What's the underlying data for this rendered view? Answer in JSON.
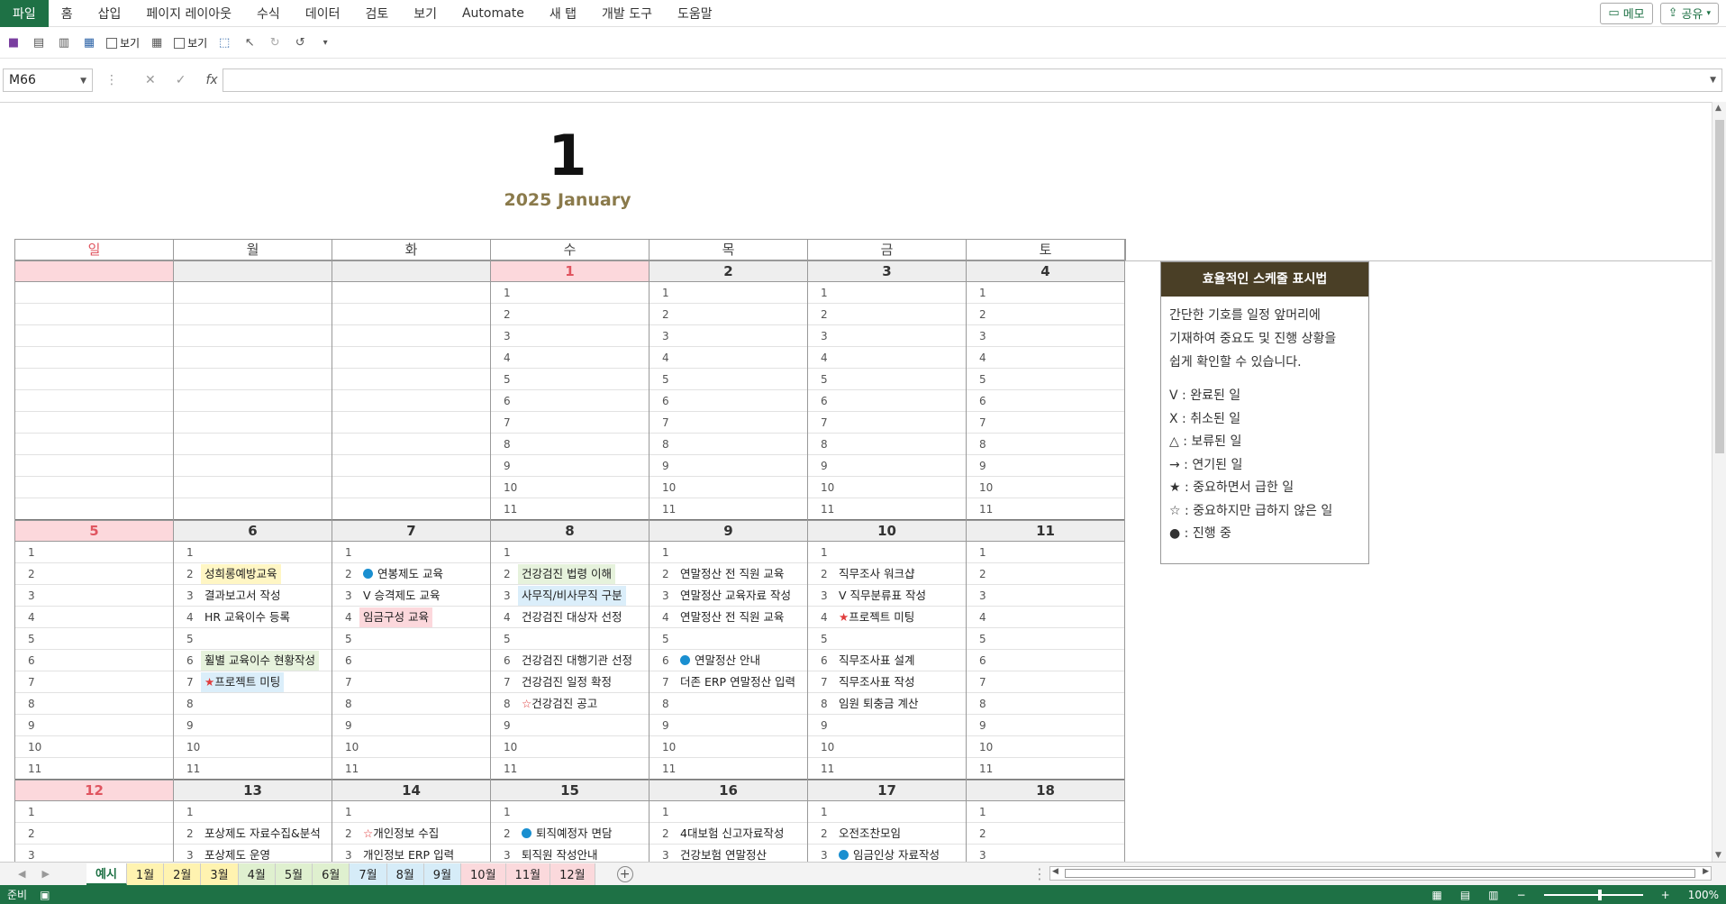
{
  "menu": {
    "file": "파일",
    "items": [
      "홈",
      "삽입",
      "페이지 레이아웃",
      "수식",
      "데이터",
      "검토",
      "보기",
      "Automate",
      "새 탭",
      "개발 도구",
      "도움말"
    ],
    "memo": "메모",
    "share": "공유"
  },
  "qat": {
    "view1": "보기",
    "view2": "보기"
  },
  "formula": {
    "cell_ref": "M66",
    "fx": "fx",
    "value": ""
  },
  "calendar": {
    "month_number": "1",
    "subtitle": "2025 January",
    "days": [
      "일",
      "월",
      "화",
      "수",
      "목",
      "금",
      "토"
    ],
    "weeks": [
      {
        "dates": [
          "",
          "",
          "",
          "1",
          "2",
          "3",
          "4"
        ],
        "rows": 11,
        "cols": [
          {
            "show_nums": false,
            "items": []
          },
          {
            "show_nums": false,
            "items": []
          },
          {
            "show_nums": false,
            "items": []
          },
          {
            "show_nums": true,
            "items": []
          },
          {
            "show_nums": true,
            "items": []
          },
          {
            "show_nums": true,
            "items": []
          },
          {
            "show_nums": true,
            "items": []
          }
        ]
      },
      {
        "dates": [
          "5",
          "6",
          "7",
          "8",
          "9",
          "10",
          "11"
        ],
        "rows": 11,
        "cols": [
          {
            "show_nums": true,
            "items": []
          },
          {
            "show_nums": true,
            "items": [
              {
                "row": 2,
                "text": "성희롱예방교육",
                "bg": "yellow"
              },
              {
                "row": 3,
                "text": "결과보고서 작성"
              },
              {
                "row": 4,
                "text": "HR 교육이수 등록"
              },
              {
                "row": 6,
                "text": "휠별 교육이수 현황작성",
                "bg": "green"
              },
              {
                "row": 7,
                "text": "프로젝트 미팅",
                "prefix": "★",
                "bg": "blue"
              }
            ]
          },
          {
            "show_nums": true,
            "items": [
              {
                "row": 2,
                "text": "연봉제도 교육",
                "prefix": "dot"
              },
              {
                "row": 3,
                "text": "V 승격제도 교육"
              },
              {
                "row": 4,
                "text": "임금구성 교육",
                "bg": "pink"
              }
            ]
          },
          {
            "show_nums": true,
            "items": [
              {
                "row": 2,
                "text": "건강검진 법령 이해",
                "bg": "green"
              },
              {
                "row": 3,
                "text": "사무직/비사무직 구분",
                "bg": "blue"
              },
              {
                "row": 4,
                "text": "건강검진 대상자 선정"
              },
              {
                "row": 6,
                "text": "건강검진 대행기관 선정"
              },
              {
                "row": 7,
                "text": "건강검진 일정 확정"
              },
              {
                "row": 8,
                "text": "건강검진 공고",
                "prefix": "☆"
              }
            ]
          },
          {
            "show_nums": true,
            "items": [
              {
                "row": 2,
                "text": "연말정산 전 직원 교육"
              },
              {
                "row": 3,
                "text": "연말정산 교육자료 작성"
              },
              {
                "row": 4,
                "text": "연말정산 전 직원 교육"
              },
              {
                "row": 6,
                "text": "연말정산 안내",
                "prefix": "dot"
              },
              {
                "row": 7,
                "text": "더존 ERP 연말정산 입력"
              }
            ]
          },
          {
            "show_nums": true,
            "items": [
              {
                "row": 2,
                "text": "직무조사 워크샵"
              },
              {
                "row": 3,
                "text": "V 직무분류표 작성"
              },
              {
                "row": 4,
                "text": "프로젝트 미팅",
                "prefix": "★"
              },
              {
                "row": 6,
                "text": "직무조사표 설계"
              },
              {
                "row": 7,
                "text": "직무조사표 작성"
              },
              {
                "row": 8,
                "text": "임원 퇴충금 계산"
              }
            ]
          },
          {
            "show_nums": true,
            "items": []
          }
        ]
      },
      {
        "dates": [
          "12",
          "13",
          "14",
          "15",
          "16",
          "17",
          "18"
        ],
        "rows": 3,
        "cols": [
          {
            "show_nums": true,
            "items": []
          },
          {
            "show_nums": true,
            "items": [
              {
                "row": 2,
                "text": "포상제도 자료수집&분석"
              },
              {
                "row": 3,
                "text": "포상제도 운영"
              }
            ]
          },
          {
            "show_nums": true,
            "items": [
              {
                "row": 2,
                "text": "개인정보 수집",
                "prefix": "☆"
              },
              {
                "row": 3,
                "text": "개인정보 ERP 입력"
              }
            ]
          },
          {
            "show_nums": true,
            "items": [
              {
                "row": 2,
                "text": "퇴직예정자 면담",
                "prefix": "dot"
              },
              {
                "row": 3,
                "text": "퇴직원 작성안내"
              }
            ]
          },
          {
            "show_nums": true,
            "items": [
              {
                "row": 2,
                "text": "4대보험 신고자료작성"
              },
              {
                "row": 3,
                "text": "건강보험 연말정산"
              }
            ]
          },
          {
            "show_nums": true,
            "items": [
              {
                "row": 2,
                "text": "오전조찬모임"
              },
              {
                "row": 3,
                "text": "임금인상 자료작성",
                "prefix": "dot"
              }
            ]
          },
          {
            "show_nums": true,
            "items": []
          }
        ]
      }
    ]
  },
  "legend": {
    "title": "효율적인 스케줄 표시법",
    "desc": [
      "간단한 기호를 일정 앞머리에",
      "기재하여 중요도 및 진행 상황을",
      "쉽게 확인할 수 있습니다."
    ],
    "items": [
      "V : 완료된 일",
      "X : 취소된 일",
      "△ : 보류된 일",
      "→ : 연기된 일",
      "★ : 중요하면서 급한 일",
      "☆ : 중요하지만 급하지 않은 일",
      "● : 진행 중"
    ]
  },
  "tabs": [
    {
      "label": "예시",
      "style": "active"
    },
    {
      "label": "1월",
      "style": "y"
    },
    {
      "label": "2월",
      "style": "y"
    },
    {
      "label": "3월",
      "style": "y"
    },
    {
      "label": "4월",
      "style": "g"
    },
    {
      "label": "5월",
      "style": "g"
    },
    {
      "label": "6월",
      "style": "g"
    },
    {
      "label": "7월",
      "style": "b"
    },
    {
      "label": "8월",
      "style": "b"
    },
    {
      "label": "9월",
      "style": "b"
    },
    {
      "label": "10월",
      "style": "p"
    },
    {
      "label": "11월",
      "style": "p"
    },
    {
      "label": "12월",
      "style": "p"
    }
  ],
  "status": {
    "ready": "준비",
    "zoom": "100%"
  }
}
